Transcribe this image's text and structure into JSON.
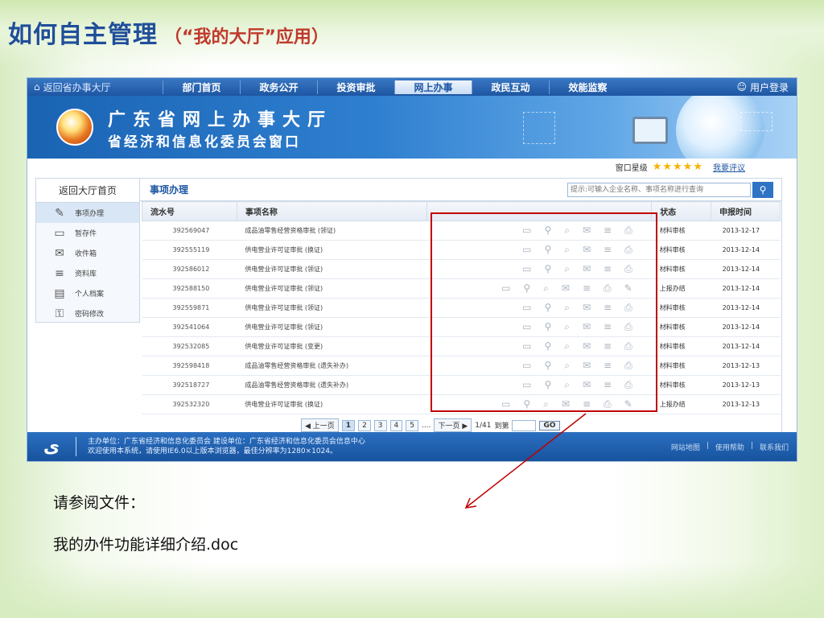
{
  "slide": {
    "title": "如何自主管理",
    "subtitle": "（“我的大厅”应用）"
  },
  "nav": {
    "home": "返回省办事大厅",
    "items": [
      "部门首页",
      "政务公开",
      "投资审批",
      "网上办事",
      "政民互动",
      "效能监察"
    ],
    "login": "用户登录"
  },
  "banner": {
    "title": "广东省网上办事大厅",
    "subtitle": "省经济和信息化委员会窗口"
  },
  "rating": {
    "label": "窗口星级",
    "stars": "★★★★★",
    "comment": "我要评议"
  },
  "sidebar": {
    "back": "返回大厅首页",
    "items": [
      "事项办理",
      "暂存件",
      "收件箱",
      "资料库",
      "个人档案",
      "密码修改"
    ]
  },
  "panel": {
    "title": "事项办理",
    "search_placeholder": "提示:可输入企业名称、事项名称进行查询",
    "columns": [
      "流水号",
      "事项名称",
      "",
      "状态",
      "申报时间"
    ],
    "rows": [
      {
        "no": "392569047",
        "name": "成品油零售经营资格审批 (领证)",
        "ops": "▭⚲⌕✉≡⎙",
        "status": "材料审核",
        "date": "2013-12-17"
      },
      {
        "no": "392555119",
        "name": "供电营业许可证审批 (换证)",
        "ops": "▭⚲⌕✉≡⎙",
        "status": "材料审核",
        "date": "2013-12-14"
      },
      {
        "no": "392586012",
        "name": "供电营业许可证审批 (领证)",
        "ops": "▭⚲⌕✉≡⎙",
        "status": "材料审核",
        "date": "2013-12-14"
      },
      {
        "no": "392588150",
        "name": "供电营业许可证审批 (领证)",
        "ops": "▭⚲⌕✉≡⎙✎",
        "status": "上报办结",
        "date": "2013-12-14"
      },
      {
        "no": "392559871",
        "name": "供电营业许可证审批 (领证)",
        "ops": "▭⚲⌕✉≡⎙",
        "status": "材料审核",
        "date": "2013-12-14"
      },
      {
        "no": "392541064",
        "name": "供电营业许可证审批 (领证)",
        "ops": "▭⚲⌕✉≡⎙",
        "status": "材料审核",
        "date": "2013-12-14"
      },
      {
        "no": "392532085",
        "name": "供电营业许可证审批 (变更)",
        "ops": "▭⚲⌕✉≡⎙",
        "status": "材料审核",
        "date": "2013-12-14"
      },
      {
        "no": "392598418",
        "name": "成品油零售经营资格审批 (遗失补办)",
        "ops": "▭⚲⌕✉≡⎙",
        "status": "材料审核",
        "date": "2013-12-13"
      },
      {
        "no": "392518727",
        "name": "成品油零售经营资格审批 (遗失补办)",
        "ops": "▭⚲⌕✉≡⎙",
        "status": "材料审核",
        "date": "2013-12-13"
      },
      {
        "no": "392532320",
        "name": "供电营业许可证审批 (换证)",
        "ops": "▭⚲⌕✉≡⎙✎",
        "status": "上报办结",
        "date": "2013-12-13"
      }
    ]
  },
  "pager": {
    "prev": "◀ 上一页",
    "pages": [
      "1",
      "2",
      "3",
      "4",
      "5"
    ],
    "ellipsis": "....",
    "next": "下一页 ▶",
    "total": "1/41",
    "jump": "到第",
    "go": "GO"
  },
  "footer": {
    "logo": "ى",
    "line1": "主办单位：广东省经济和信息化委员会    建设单位：广东省经济和信息化委员会信息中心",
    "line2": "欢迎使用本系统，请使用IE6.0以上版本浏览器，最佳分辨率为1280×1024。",
    "links": [
      "网站地图",
      "|",
      "使用帮助",
      "|",
      "联系我们"
    ]
  },
  "notes": {
    "line1": "请参阅文件：",
    "line2": "我的办件功能详细介绍.doc"
  },
  "colors": {
    "title_blue": "#1f4e9a",
    "subtitle_red": "#c0392b",
    "nav_blue": "#1d56a2",
    "callout_red": "#c00000"
  }
}
